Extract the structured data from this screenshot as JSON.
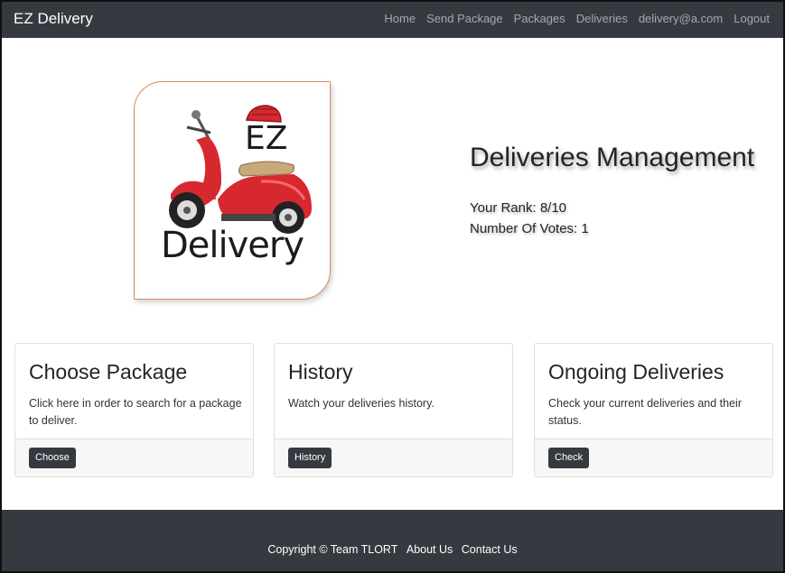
{
  "navbar": {
    "brand": "EZ Delivery",
    "links": [
      "Home",
      "Send Package",
      "Packages",
      "Deliveries",
      "delivery@a.com",
      "Logout"
    ]
  },
  "logo": {
    "ez_text": "EZ",
    "word": "Delivery",
    "scooter_color": "#d8282f"
  },
  "hero": {
    "title": "Deliveries Management",
    "rank": "Your Rank: 8/10",
    "votes": "Number Of Votes: 1"
  },
  "cards": [
    {
      "title": "Choose Package",
      "text": "Click here in order to search for a package to deliver.",
      "button": "Choose"
    },
    {
      "title": "History",
      "text": "Watch your deliveries history.",
      "button": "History"
    },
    {
      "title": "Ongoing Deliveries",
      "text": "Check your current deliveries and their status.",
      "button": "Check"
    }
  ],
  "footer": {
    "copyright": "Copyright © Team TLORT",
    "about": "About Us",
    "contact": "Contact Us"
  },
  "colors": {
    "navbar_bg": "#343a40",
    "button_bg": "#343a40",
    "logo_border": "#d98c5f"
  }
}
